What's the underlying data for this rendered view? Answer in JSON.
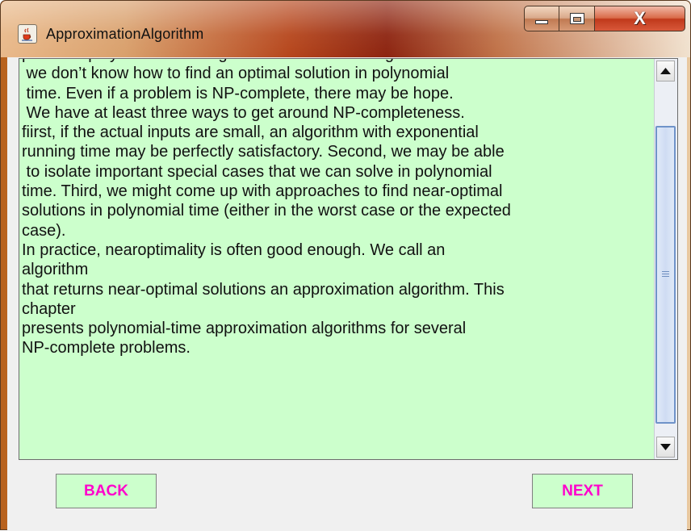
{
  "window": {
    "title": "ApproximationAlgorithm",
    "app_icon": "java-coffee-cup-icon",
    "controls": {
      "minimize_icon": "minimize-icon",
      "maximize_icon": "maximize-icon",
      "close_icon": "close-icon",
      "close_label": "X"
    }
  },
  "content": {
    "background": "#ccffcc",
    "lines": [
      "presents polynomial-time algorithms. The known algorithms are",
      " we don’t know how to find an optimal solution in polynomial",
      " time. Even if a problem is NP-complete, there may be hope.",
      " We have at least three ways to get around NP-completeness.",
      "fiirst, if the actual inputs are small, an algorithm with exponential",
      "running time may be perfectly satisfactory. Second, we may be able",
      " to isolate important special cases that we can solve in polynomial",
      "time. Third, we might come up with approaches to find near-optimal",
      "solutions in polynomial time (either in the worst case or the expected",
      "case).",
      "In practice, nearoptimality is often good enough. We call an",
      "algorithm",
      "that returns near-optimal solutions an approximation algorithm. This",
      "chapter",
      "presents polynomial-time approximation algorithms for several",
      "NP-complete problems."
    ]
  },
  "scrollbar": {
    "up_icon": "scroll-up-arrow-icon",
    "down_icon": "scroll-down-arrow-icon",
    "thumb_grip_icon": "scroll-grip-icon"
  },
  "buttons": {
    "back_label": "BACK",
    "next_label": "NEXT",
    "label_color": "#ff00cc",
    "background": "#ccffcc"
  }
}
